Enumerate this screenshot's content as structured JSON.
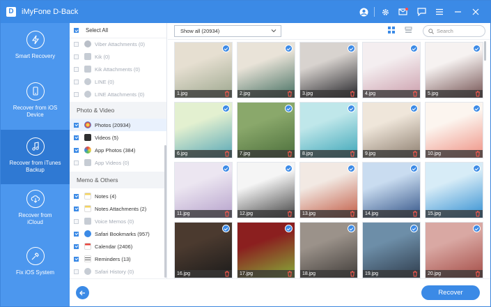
{
  "app": {
    "logo_letter": "D",
    "title": "iMyFone D-Back"
  },
  "nav": [
    {
      "label": "Smart Recovery",
      "icon": "lightning-icon",
      "active": false
    },
    {
      "label": "Recover from iOS Device",
      "icon": "phone-refresh-icon",
      "active": false
    },
    {
      "label": "Recover from iTunes Backup",
      "icon": "music-note-icon",
      "active": true
    },
    {
      "label": "Recover from iCloud",
      "icon": "cloud-download-icon",
      "active": false
    },
    {
      "label": "Fix iOS System",
      "icon": "wrench-icon",
      "active": false
    }
  ],
  "categories": {
    "select_all": "Select All",
    "top_items": [
      {
        "label": "Viber Attachments (0)",
        "checked": false,
        "disabled": true,
        "icon_color": "#b9bfc8"
      },
      {
        "label": "Kik (0)",
        "checked": false,
        "disabled": true,
        "icon_color": "#c6ccd4"
      },
      {
        "label": "Kik Attachments (0)",
        "checked": false,
        "disabled": true,
        "icon_color": "#c6ccd4"
      },
      {
        "label": "LINE (0)",
        "checked": false,
        "disabled": true,
        "icon_color": "#c6ccd4"
      },
      {
        "label": "LINE Attachments (0)",
        "checked": false,
        "disabled": true,
        "icon_color": "#c6ccd4"
      }
    ],
    "photo_video_header": "Photo & Video",
    "photo_items": [
      {
        "label": "Photos (20934)",
        "checked": true,
        "disabled": false,
        "icon_color": "#f0a33a",
        "highlight": true
      },
      {
        "label": "Videos (5)",
        "checked": true,
        "disabled": false,
        "icon_color": "#2f2f2f",
        "highlight": false
      },
      {
        "label": "App Photos (384)",
        "checked": true,
        "disabled": false,
        "icon_color": "#e8483f",
        "highlight": false
      },
      {
        "label": "App Videos (0)",
        "checked": false,
        "disabled": true,
        "icon_color": "#c6ccd4",
        "highlight": false
      }
    ],
    "memo_header": "Memo & Others",
    "memo_items": [
      {
        "label": "Notes (4)",
        "checked": true,
        "disabled": false,
        "icon_color": "#f4d35e"
      },
      {
        "label": "Notes Attachments (2)",
        "checked": true,
        "disabled": false,
        "icon_color": "#f4d35e"
      },
      {
        "label": "Voice Memos (0)",
        "checked": false,
        "disabled": true,
        "icon_color": "#c6ccd4"
      },
      {
        "label": "Safari Bookmarks (957)",
        "checked": true,
        "disabled": false,
        "icon_color": "#3b8ae6"
      },
      {
        "label": "Calendar (2406)",
        "checked": true,
        "disabled": false,
        "icon_color": "#e8483f"
      },
      {
        "label": "Reminders (13)",
        "checked": true,
        "disabled": false,
        "icon_color": "#5a5a5a"
      },
      {
        "label": "Safari History (0)",
        "checked": false,
        "disabled": true,
        "icon_color": "#c6ccd4"
      }
    ]
  },
  "toolbar": {
    "filter_value": "Show all (20934)",
    "search_placeholder": "Search"
  },
  "photos": [
    {
      "name": "1.jpg",
      "c1": "#e6dfd1",
      "c2": "#9aa58c"
    },
    {
      "name": "2.jpg",
      "c1": "#e9e3d8",
      "c2": "#3f6b5d"
    },
    {
      "name": "3.jpg",
      "c1": "#d8d3cf",
      "c2": "#1f1f24"
    },
    {
      "name": "4.jpg",
      "c1": "#f4eef0",
      "c2": "#c99aa8"
    },
    {
      "name": "5.jpg",
      "c1": "#f6f2f1",
      "c2": "#6e4b4b"
    },
    {
      "name": "6.jpg",
      "c1": "#e3f0d0",
      "c2": "#52a4b5"
    },
    {
      "name": "7.jpg",
      "c1": "#8aa86b",
      "c2": "#4a6d3a"
    },
    {
      "name": "8.jpg",
      "c1": "#bfe7ea",
      "c2": "#38a3b6"
    },
    {
      "name": "9.jpg",
      "c1": "#efe6da",
      "c2": "#8a7b6c"
    },
    {
      "name": "10.jpg",
      "c1": "#fcf5ef",
      "c2": "#ee8c7e"
    },
    {
      "name": "11.jpg",
      "c1": "#ece6f1",
      "c2": "#b39ec9"
    },
    {
      "name": "12.jpg",
      "c1": "#f5f5f5",
      "c2": "#3d3d3d"
    },
    {
      "name": "13.jpg",
      "c1": "#f2e9e3",
      "c2": "#c0563f"
    },
    {
      "name": "14.jpg",
      "c1": "#c9dcf0",
      "c2": "#2e4f84"
    },
    {
      "name": "15.jpg",
      "c1": "#d7ecf7",
      "c2": "#2c8bd0"
    },
    {
      "name": "16.jpg",
      "c1": "#4b3a2f",
      "c2": "#1a1a1a"
    },
    {
      "name": "17.jpg",
      "c1": "#8b1f1f",
      "c2": "#86b33a"
    },
    {
      "name": "18.jpg",
      "c1": "#9b928a",
      "c2": "#3e3a37"
    },
    {
      "name": "19.jpg",
      "c1": "#6d8ea8",
      "c2": "#2d3a4a"
    },
    {
      "name": "20.jpg",
      "c1": "#d9a8a3",
      "c2": "#a34a44"
    }
  ],
  "bottom": {
    "recover_label": "Recover"
  }
}
